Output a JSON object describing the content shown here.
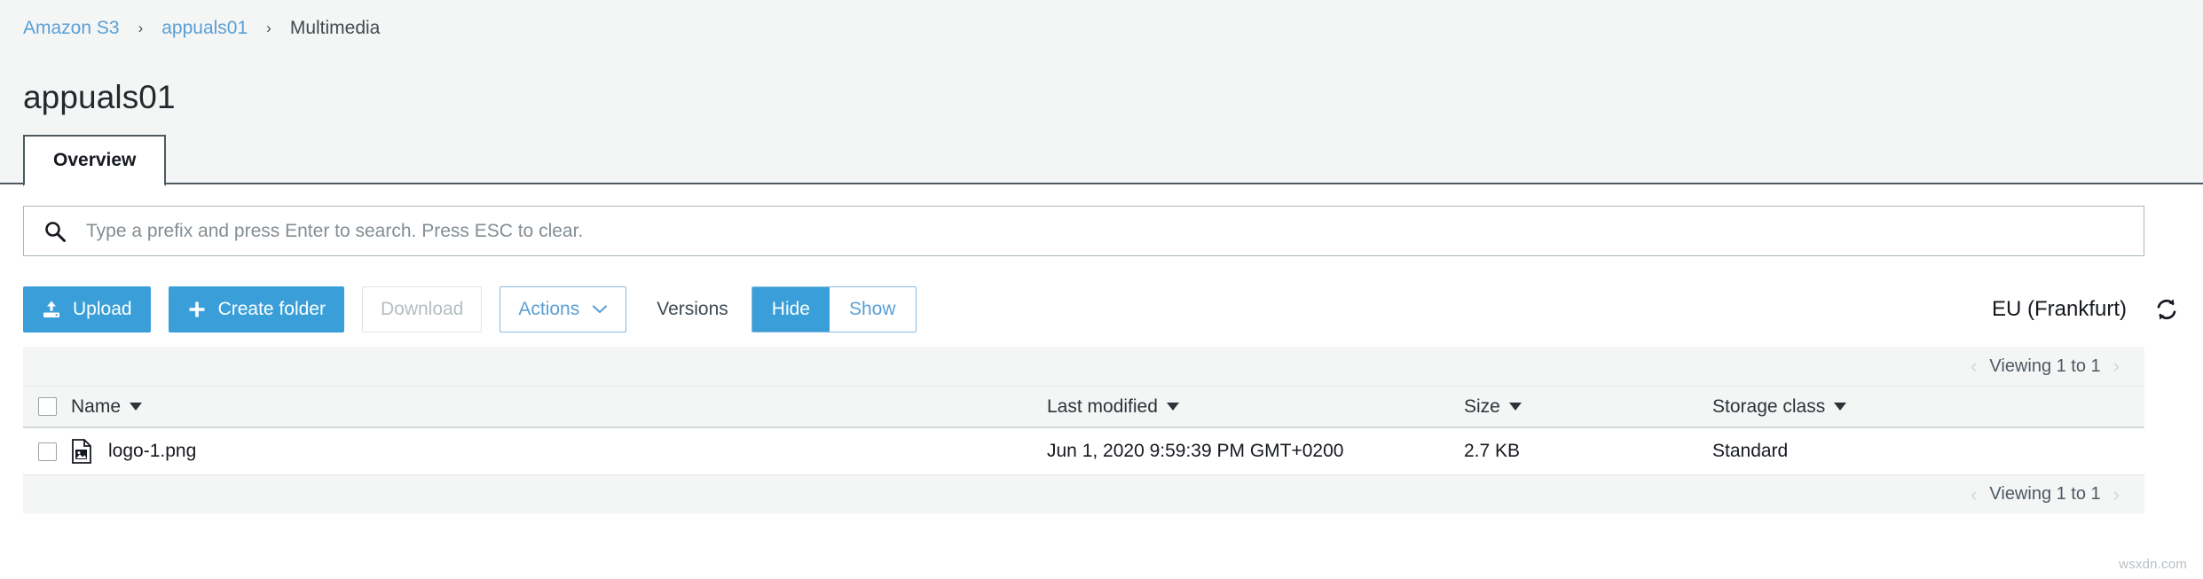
{
  "breadcrumb": {
    "separator": "›",
    "items": [
      {
        "label": "Amazon S3",
        "type": "link"
      },
      {
        "label": "appuals01",
        "type": "link"
      },
      {
        "label": "Multimedia",
        "type": "current"
      }
    ]
  },
  "page_title": "appuals01",
  "tabs": [
    {
      "label": "Overview",
      "active": true
    }
  ],
  "search": {
    "placeholder": "Type a prefix and press Enter to search. Press ESC to clear.",
    "value": "",
    "icon": "search-icon"
  },
  "toolbar": {
    "upload_label": "Upload",
    "upload_icon": "upload-icon",
    "create_folder_label": "Create folder",
    "create_folder_icon": "plus-icon",
    "download_label": "Download",
    "actions_label": "Actions",
    "actions_icon": "chevron-down-icon",
    "versions_label": "Versions",
    "versions_hide_label": "Hide",
    "versions_show_label": "Show",
    "versions_selected": "Hide"
  },
  "region": {
    "label": "EU (Frankfurt)",
    "refresh_icon": "refresh-icon"
  },
  "pagination": {
    "text": "Viewing 1 to 1",
    "prev_icon": "chevron-left-icon",
    "next_icon": "chevron-right-icon"
  },
  "table": {
    "columns": [
      {
        "label": "Name",
        "sortable": true
      },
      {
        "label": "Last modified",
        "sortable": true
      },
      {
        "label": "Size",
        "sortable": true
      },
      {
        "label": "Storage class",
        "sortable": true
      }
    ],
    "rows": [
      {
        "name": "logo-1.png",
        "icon": "image-file-icon",
        "last_modified": "Jun 1, 2020 9:59:39 PM GMT+0200",
        "size": "2.7 KB",
        "storage_class": "Standard",
        "selected": false
      }
    ]
  },
  "watermark": "wsxdn.com",
  "colors": {
    "accent": "#3a9fd8",
    "link": "#5a9fd4",
    "header_bg": "#f4f6f5",
    "row_header_bg": "#f4f5f5",
    "tab_border": "#4c5a60",
    "text": "#16191f"
  }
}
